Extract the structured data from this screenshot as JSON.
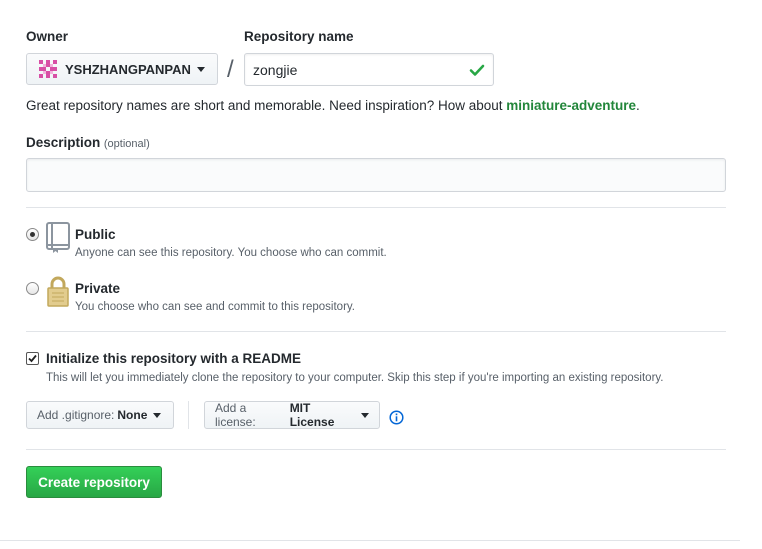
{
  "owner": {
    "label": "Owner",
    "value": "YSHZHANGPANPAN"
  },
  "separator": "/",
  "repo": {
    "label": "Repository name",
    "value": "zongjie"
  },
  "hint": {
    "prefix": "Great repository names are short and memorable. Need inspiration? How about ",
    "suggestion": "miniature-adventure",
    "suffix": "."
  },
  "description": {
    "label": "Description",
    "optional": "(optional)",
    "value": ""
  },
  "visibility": {
    "public": {
      "title": "Public",
      "note": "Anyone can see this repository. You choose who can commit.",
      "selected": true
    },
    "private": {
      "title": "Private",
      "note": "You choose who can see and commit to this repository.",
      "selected": false
    }
  },
  "readme": {
    "label": "Initialize this repository with a README",
    "note": "This will let you immediately clone the repository to your computer. Skip this step if you're importing an existing repository.",
    "checked": true
  },
  "gitignore": {
    "prefix": "Add .gitignore:",
    "value": "None"
  },
  "license": {
    "prefix": "Add a license:",
    "value": "MIT License"
  },
  "create_button": "Create repository",
  "colors": {
    "accent_green": "#28a745",
    "check_green": "#28a745",
    "info_blue": "#0366d6"
  }
}
